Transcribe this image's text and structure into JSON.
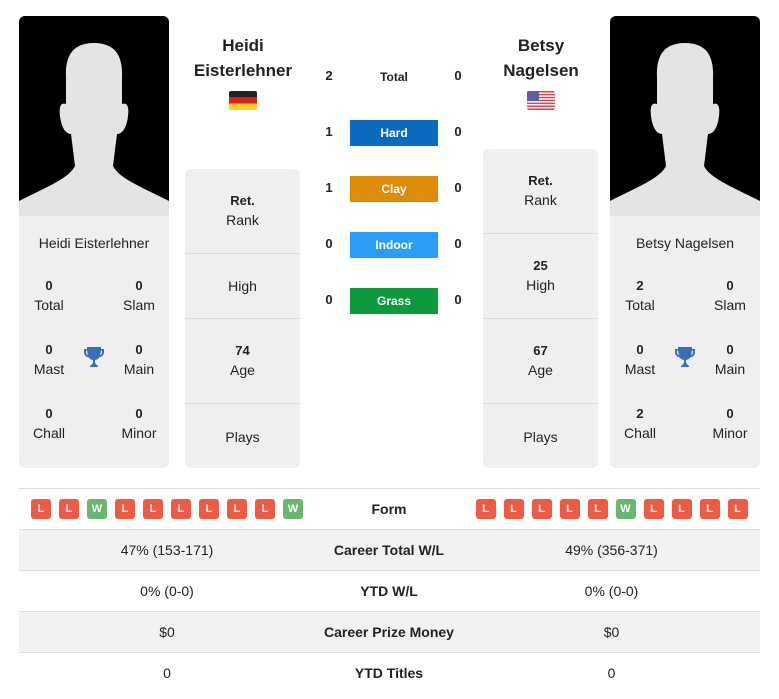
{
  "players": [
    {
      "name_line1": "Heidi",
      "name_line2": "Eisterlehner",
      "full_name": "Heidi Eisterlehner",
      "flag": "germany-flag",
      "titles": {
        "total": "0",
        "total_label": "Total",
        "slam": "0",
        "slam_label": "Slam",
        "mast": "0",
        "mast_label": "Mast",
        "main": "0",
        "main_label": "Main",
        "chall": "0",
        "chall_label": "Chall",
        "minor": "0",
        "minor_label": "Minor"
      },
      "info": {
        "rank_value": "Ret.",
        "rank_label": "Rank",
        "high_value": "",
        "high_label": "High",
        "age_value": "74",
        "age_label": "Age",
        "plays_value": "",
        "plays_label": "Plays"
      },
      "form": [
        "L",
        "L",
        "W",
        "L",
        "L",
        "L",
        "L",
        "L",
        "L",
        "W"
      ],
      "career_total_wl": "47% (153-171)",
      "ytd_wl": "0% (0-0)",
      "career_prize_money": "$0",
      "ytd_titles": "0"
    },
    {
      "name_line1": "Betsy",
      "name_line2": "Nagelsen",
      "full_name": "Betsy Nagelsen",
      "flag": "usa-flag",
      "titles": {
        "total": "2",
        "total_label": "Total",
        "slam": "0",
        "slam_label": "Slam",
        "mast": "0",
        "mast_label": "Mast",
        "main": "0",
        "main_label": "Main",
        "chall": "2",
        "chall_label": "Chall",
        "minor": "0",
        "minor_label": "Minor"
      },
      "info": {
        "rank_value": "Ret.",
        "rank_label": "Rank",
        "high_value": "25",
        "high_label": "High",
        "age_value": "67",
        "age_label": "Age",
        "plays_value": "",
        "plays_label": "Plays"
      },
      "form": [
        "L",
        "L",
        "L",
        "L",
        "L",
        "W",
        "L",
        "L",
        "L",
        "L"
      ],
      "career_total_wl": "49% (356-371)",
      "ytd_wl": "0% (0-0)",
      "career_prize_money": "$0",
      "ytd_titles": "0"
    }
  ],
  "h2h": [
    {
      "label": "Total",
      "left": "2",
      "right": "0",
      "color": ""
    },
    {
      "label": "Hard",
      "left": "1",
      "right": "0",
      "color": "#0a6abf"
    },
    {
      "label": "Clay",
      "left": "1",
      "right": "0",
      "color": "#de8b08"
    },
    {
      "label": "Indoor",
      "left": "0",
      "right": "0",
      "color": "#2b9df4"
    },
    {
      "label": "Grass",
      "left": "0",
      "right": "0",
      "color": "#0c9a3c"
    }
  ],
  "stats_labels": {
    "form": "Form",
    "career_total_wl": "Career Total W/L",
    "ytd_wl": "YTD W/L",
    "career_prize_money": "Career Prize Money",
    "ytd_titles": "YTD Titles"
  },
  "colors": {
    "loss": "#ee5b45",
    "win": "#6ab86e",
    "trophy": "#3a6fb8"
  }
}
